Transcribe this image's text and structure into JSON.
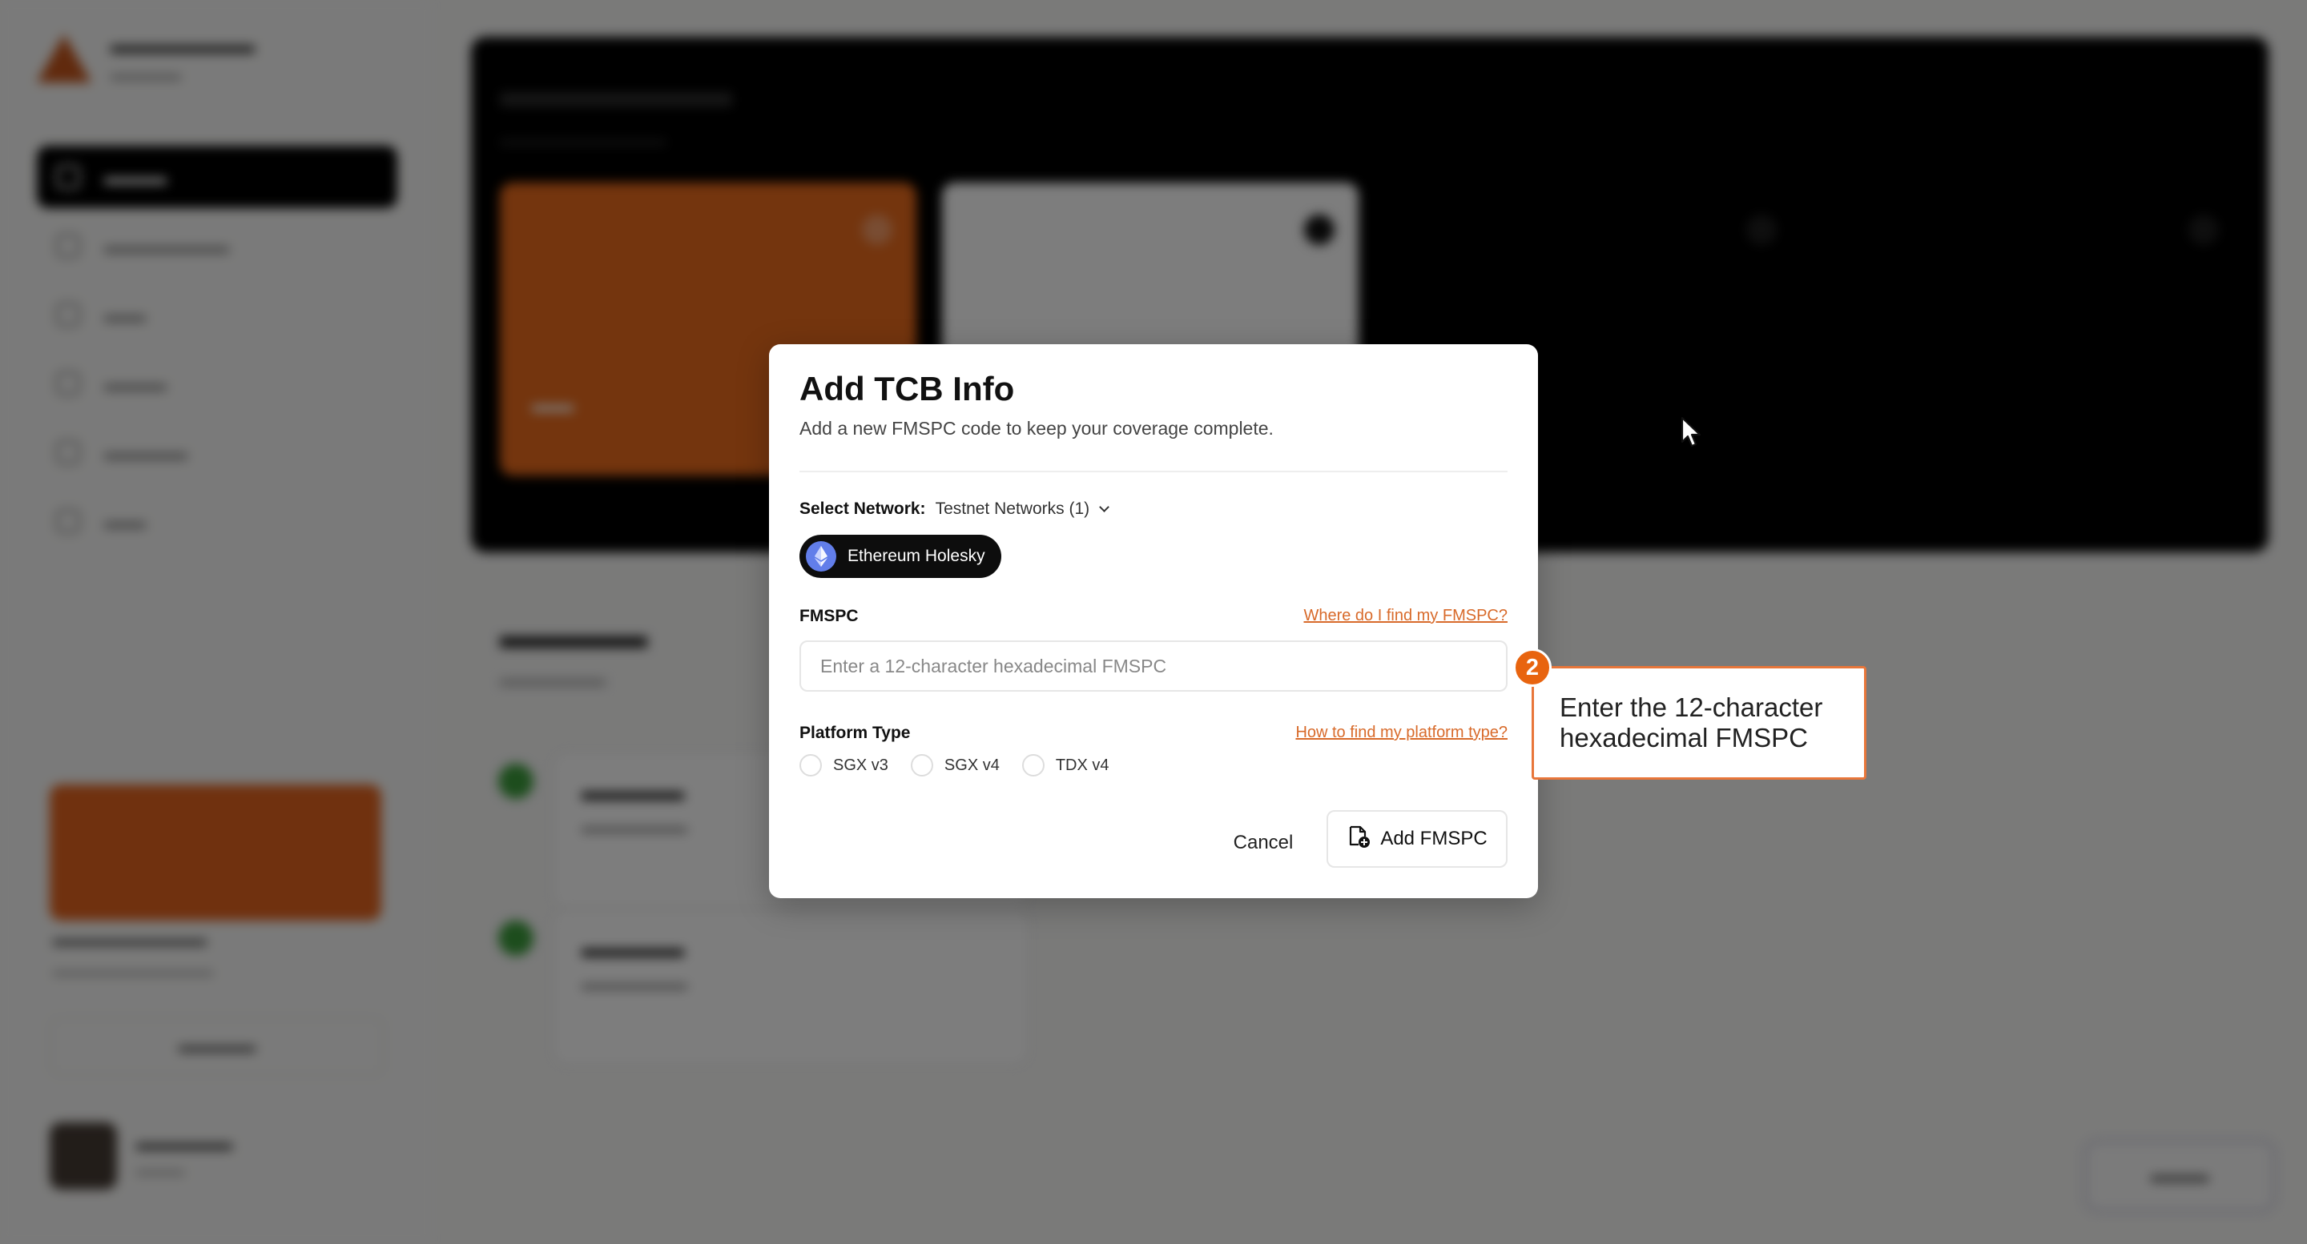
{
  "modal": {
    "title": "Add TCB Info",
    "subtitle": "Add a new FMSPC code to keep your coverage complete.",
    "network_label": "Select Network:",
    "network_value": "Testnet Networks (1)",
    "selected_network_chip": "Ethereum Holesky",
    "fmspc_label": "FMSPC",
    "fmspc_help_link": "Where do I find my FMSPC?",
    "fmspc_value": "",
    "fmspc_placeholder": "Enter a 12-character hexadecimal FMSPC",
    "platform_label": "Platform Type",
    "platform_help_link": "How to find my platform type?",
    "platform_options": [
      {
        "label": "SGX v3",
        "selected": false
      },
      {
        "label": "SGX v4",
        "selected": false
      },
      {
        "label": "TDX v4",
        "selected": false
      }
    ],
    "cancel_label": "Cancel",
    "submit_label": "Add FMSPC"
  },
  "tooltip": {
    "step": "2",
    "text": "Enter the 12-character hexadecimal FMSPC"
  },
  "colors": {
    "accent": "#e8640f",
    "link": "#d86a2a",
    "chip_bg": "#0d0d0d",
    "ethereum": "#627eea",
    "tooltip_border": "#e8763a",
    "overlay": "rgba(0,0,0,0.5)"
  },
  "icons": {
    "network_chevron": "chevron-down-icon",
    "chip_icon": "ethereum-icon",
    "submit_icon": "add-document-icon",
    "pointer": "mouse-cursor-icon"
  }
}
